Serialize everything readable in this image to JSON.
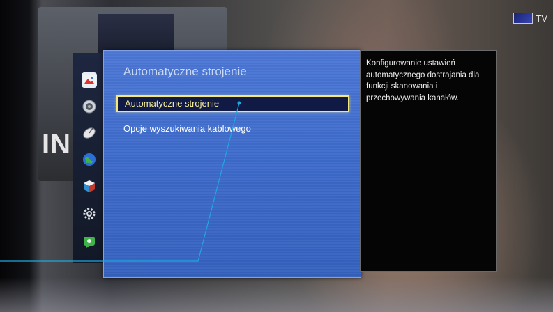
{
  "tv_badge": {
    "label": "TV"
  },
  "background": {
    "text": "INI"
  },
  "menu": {
    "title": "Automatyczne strojenie",
    "items": [
      {
        "label": "Automatyczne strojenie",
        "selected": true
      },
      {
        "label": "Opcje wyszukiwania kablowego",
        "selected": false
      }
    ]
  },
  "description": {
    "text": "Konfigurowanie ustawień automatycznego dostrajania dla funkcji skanowania i przechowywania kanałów."
  },
  "sidebar_icons": [
    {
      "name": "picture-icon"
    },
    {
      "name": "sound-icon"
    },
    {
      "name": "satellite-dish-icon"
    },
    {
      "name": "globe-icon"
    },
    {
      "name": "box-icon"
    },
    {
      "name": "gear-icon"
    },
    {
      "name": "support-icon"
    }
  ],
  "colors": {
    "panel_blue": "#3f6ccc",
    "highlight_border": "#f4e87a",
    "highlight_text": "#f7ef9a",
    "pointer_line": "#1fa8e0"
  }
}
